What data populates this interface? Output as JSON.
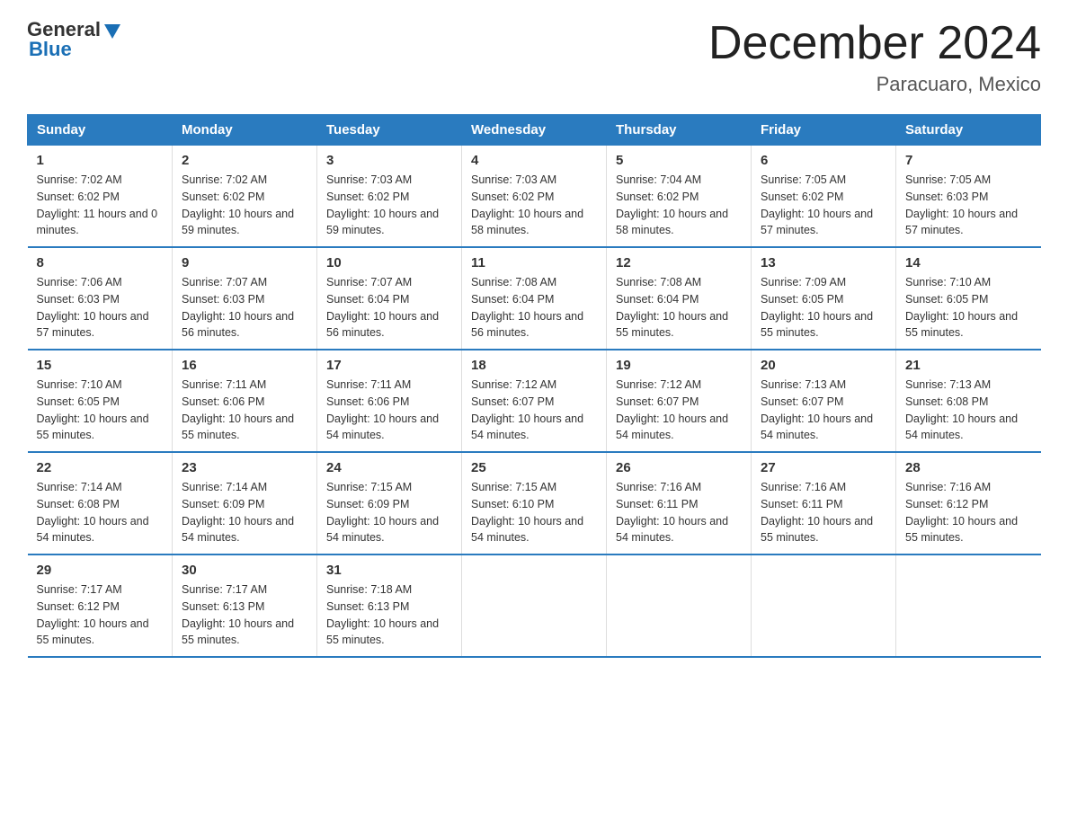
{
  "header": {
    "logo_general": "General",
    "logo_blue": "Blue",
    "title": "December 2024",
    "subtitle": "Paracuaro, Mexico"
  },
  "days_of_week": [
    "Sunday",
    "Monday",
    "Tuesday",
    "Wednesday",
    "Thursday",
    "Friday",
    "Saturday"
  ],
  "weeks": [
    [
      {
        "day": "1",
        "sunrise": "7:02 AM",
        "sunset": "6:02 PM",
        "daylight": "11 hours and 0 minutes."
      },
      {
        "day": "2",
        "sunrise": "7:02 AM",
        "sunset": "6:02 PM",
        "daylight": "10 hours and 59 minutes."
      },
      {
        "day": "3",
        "sunrise": "7:03 AM",
        "sunset": "6:02 PM",
        "daylight": "10 hours and 59 minutes."
      },
      {
        "day": "4",
        "sunrise": "7:03 AM",
        "sunset": "6:02 PM",
        "daylight": "10 hours and 58 minutes."
      },
      {
        "day": "5",
        "sunrise": "7:04 AM",
        "sunset": "6:02 PM",
        "daylight": "10 hours and 58 minutes."
      },
      {
        "day": "6",
        "sunrise": "7:05 AM",
        "sunset": "6:02 PM",
        "daylight": "10 hours and 57 minutes."
      },
      {
        "day": "7",
        "sunrise": "7:05 AM",
        "sunset": "6:03 PM",
        "daylight": "10 hours and 57 minutes."
      }
    ],
    [
      {
        "day": "8",
        "sunrise": "7:06 AM",
        "sunset": "6:03 PM",
        "daylight": "10 hours and 57 minutes."
      },
      {
        "day": "9",
        "sunrise": "7:07 AM",
        "sunset": "6:03 PM",
        "daylight": "10 hours and 56 minutes."
      },
      {
        "day": "10",
        "sunrise": "7:07 AM",
        "sunset": "6:04 PM",
        "daylight": "10 hours and 56 minutes."
      },
      {
        "day": "11",
        "sunrise": "7:08 AM",
        "sunset": "6:04 PM",
        "daylight": "10 hours and 56 minutes."
      },
      {
        "day": "12",
        "sunrise": "7:08 AM",
        "sunset": "6:04 PM",
        "daylight": "10 hours and 55 minutes."
      },
      {
        "day": "13",
        "sunrise": "7:09 AM",
        "sunset": "6:05 PM",
        "daylight": "10 hours and 55 minutes."
      },
      {
        "day": "14",
        "sunrise": "7:10 AM",
        "sunset": "6:05 PM",
        "daylight": "10 hours and 55 minutes."
      }
    ],
    [
      {
        "day": "15",
        "sunrise": "7:10 AM",
        "sunset": "6:05 PM",
        "daylight": "10 hours and 55 minutes."
      },
      {
        "day": "16",
        "sunrise": "7:11 AM",
        "sunset": "6:06 PM",
        "daylight": "10 hours and 55 minutes."
      },
      {
        "day": "17",
        "sunrise": "7:11 AM",
        "sunset": "6:06 PM",
        "daylight": "10 hours and 54 minutes."
      },
      {
        "day": "18",
        "sunrise": "7:12 AM",
        "sunset": "6:07 PM",
        "daylight": "10 hours and 54 minutes."
      },
      {
        "day": "19",
        "sunrise": "7:12 AM",
        "sunset": "6:07 PM",
        "daylight": "10 hours and 54 minutes."
      },
      {
        "day": "20",
        "sunrise": "7:13 AM",
        "sunset": "6:07 PM",
        "daylight": "10 hours and 54 minutes."
      },
      {
        "day": "21",
        "sunrise": "7:13 AM",
        "sunset": "6:08 PM",
        "daylight": "10 hours and 54 minutes."
      }
    ],
    [
      {
        "day": "22",
        "sunrise": "7:14 AM",
        "sunset": "6:08 PM",
        "daylight": "10 hours and 54 minutes."
      },
      {
        "day": "23",
        "sunrise": "7:14 AM",
        "sunset": "6:09 PM",
        "daylight": "10 hours and 54 minutes."
      },
      {
        "day": "24",
        "sunrise": "7:15 AM",
        "sunset": "6:09 PM",
        "daylight": "10 hours and 54 minutes."
      },
      {
        "day": "25",
        "sunrise": "7:15 AM",
        "sunset": "6:10 PM",
        "daylight": "10 hours and 54 minutes."
      },
      {
        "day": "26",
        "sunrise": "7:16 AM",
        "sunset": "6:11 PM",
        "daylight": "10 hours and 54 minutes."
      },
      {
        "day": "27",
        "sunrise": "7:16 AM",
        "sunset": "6:11 PM",
        "daylight": "10 hours and 55 minutes."
      },
      {
        "day": "28",
        "sunrise": "7:16 AM",
        "sunset": "6:12 PM",
        "daylight": "10 hours and 55 minutes."
      }
    ],
    [
      {
        "day": "29",
        "sunrise": "7:17 AM",
        "sunset": "6:12 PM",
        "daylight": "10 hours and 55 minutes."
      },
      {
        "day": "30",
        "sunrise": "7:17 AM",
        "sunset": "6:13 PM",
        "daylight": "10 hours and 55 minutes."
      },
      {
        "day": "31",
        "sunrise": "7:18 AM",
        "sunset": "6:13 PM",
        "daylight": "10 hours and 55 minutes."
      },
      null,
      null,
      null,
      null
    ]
  ]
}
